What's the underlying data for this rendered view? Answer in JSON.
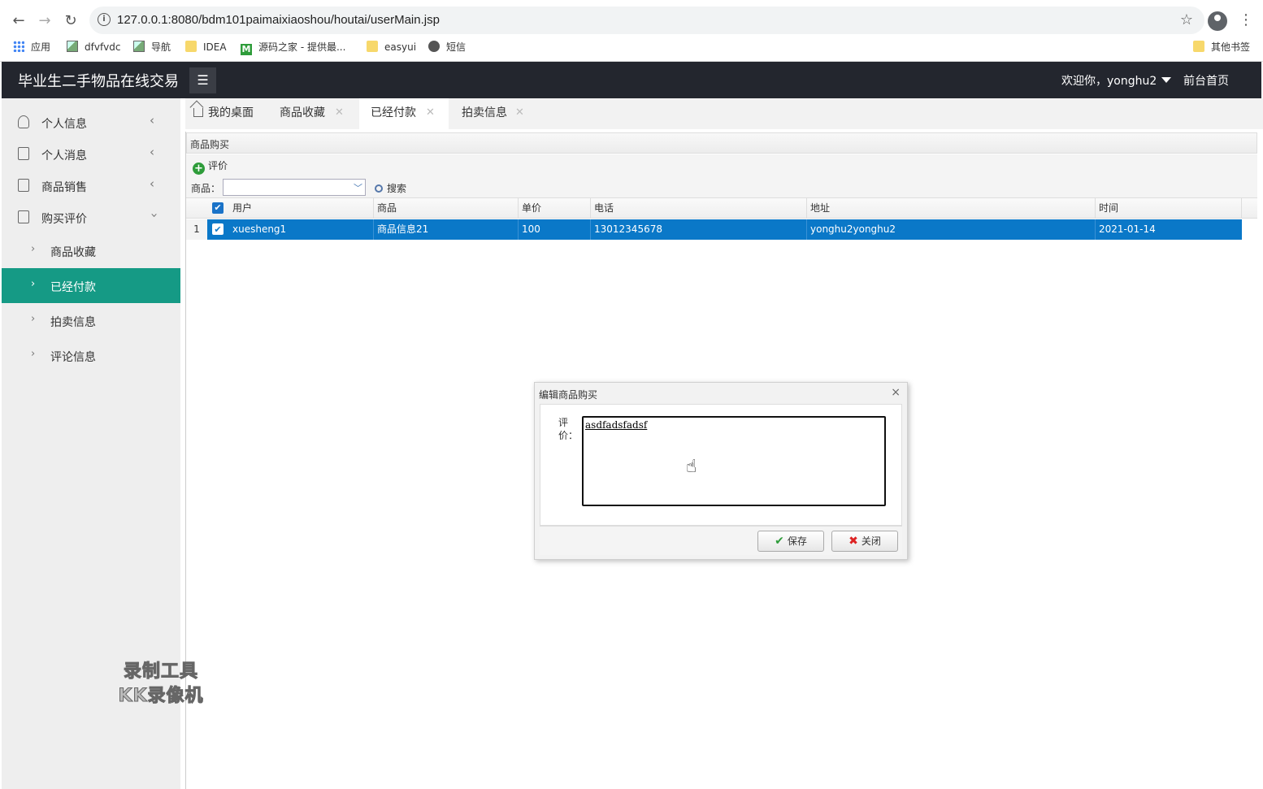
{
  "browser": {
    "url": "127.0.0.1:8080/bdm101paimaixiaoshou/houtai/userMain.jsp",
    "bookmarks": [
      "应用",
      "dfvfvdc",
      "导航",
      "IDEA",
      "源码之家 - 提供最...",
      "easyui",
      "短信"
    ],
    "other_bookmarks": "其他书签"
  },
  "header": {
    "title": "毕业生二手物品在线交易",
    "welcome": "欢迎你，yonghu2",
    "front_link": "前台首页"
  },
  "sidebar": {
    "items": [
      {
        "label": "个人信息",
        "icon": "user-icon"
      },
      {
        "label": "个人消息",
        "icon": "doc-icon"
      },
      {
        "label": "商品销售",
        "icon": "doc-icon"
      },
      {
        "label": "购买评价",
        "icon": "doc-icon"
      }
    ],
    "sub_items": [
      "商品收藏",
      "已经付款",
      "拍卖信息",
      "评论信息"
    ],
    "active_sub": "已经付款"
  },
  "tabs": [
    {
      "label": "我的桌面"
    },
    {
      "label": "商品收藏"
    },
    {
      "label": "已经付款"
    },
    {
      "label": "拍卖信息"
    }
  ],
  "panel": {
    "title": "商品购买",
    "eval_button": "评价",
    "filter_label": "商品：",
    "search_button": "搜索"
  },
  "grid": {
    "columns": [
      "用户",
      "商品",
      "单价",
      "电话",
      "地址",
      "时间"
    ],
    "rows": [
      {
        "num": "1",
        "cells": [
          "xuesheng1",
          "商品信息21",
          "100",
          "13012345678",
          "yonghu2yonghu2",
          "2021-01-14"
        ]
      }
    ]
  },
  "dialog": {
    "title": "编辑商品购买",
    "field_label": "评价：",
    "field_value": "asdfadsfadsf",
    "save_button": "保存",
    "close_button": "关闭"
  },
  "watermark": [
    "录制工具",
    "KK录像机"
  ]
}
